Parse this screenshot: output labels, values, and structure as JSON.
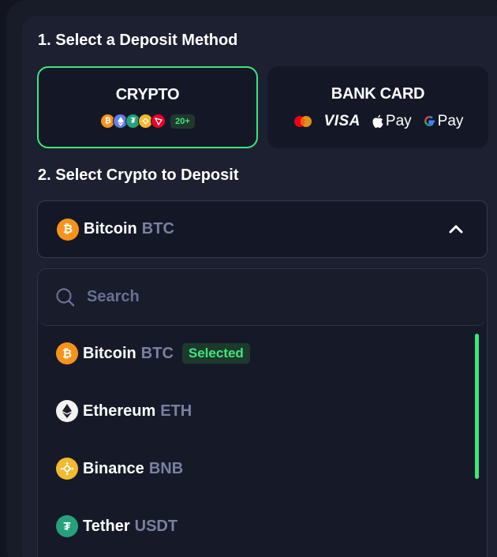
{
  "step1": {
    "title": "1. Select a Deposit Method"
  },
  "methods": {
    "crypto": {
      "label": "CRYPTO",
      "extra_count": "20+",
      "selected": true
    },
    "bank": {
      "label": "BANK CARD",
      "visa": "VISA",
      "apple_pay": "Pay",
      "google_pay": "Pay"
    }
  },
  "step2": {
    "title": "2. Select Crypto to Deposit"
  },
  "current": {
    "name": "Bitcoin",
    "ticker": "BTC",
    "icon": "bitcoin-icon"
  },
  "search": {
    "placeholder": "Search",
    "value": ""
  },
  "options": [
    {
      "name": "Bitcoin",
      "ticker": "BTC",
      "icon": "bitcoin-icon",
      "badge": "Selected"
    },
    {
      "name": "Ethereum",
      "ticker": "ETH",
      "icon": "ethereum-icon"
    },
    {
      "name": "Binance",
      "ticker": "BNB",
      "icon": "binance-icon"
    },
    {
      "name": "Tether",
      "ticker": "USDT",
      "icon": "tether-icon"
    }
  ],
  "colors": {
    "accent": "#3ee67d",
    "bitcoin": "#f7931a",
    "ethereum": "#627eea",
    "binance": "#f3ba2f",
    "tether": "#26a17b",
    "tron": "#eb0029",
    "ticker": "#7a80a0"
  }
}
